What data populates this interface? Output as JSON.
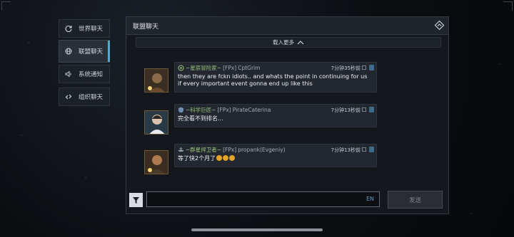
{
  "sidebar": {
    "tabs": [
      {
        "label": "世界聊天",
        "icon": "refresh-globe-icon"
      },
      {
        "label": "联盟聊天",
        "icon": "globe-icon",
        "active": true
      },
      {
        "label": "系统通知",
        "icon": "speaker-icon"
      },
      {
        "label": "组织聊天",
        "icon": "link-icon"
      }
    ]
  },
  "panel": {
    "title": "联盟聊天",
    "collapse_icon": "collapse-diamond-icon",
    "load_more": "载入更多"
  },
  "messages": [
    {
      "title": "~星辰冒险家~",
      "tag": "[FPx]",
      "name": "CptGrim",
      "time": "7分钟35秒前",
      "text": "then they are fckn idiots.. and whats the point in continuing for us if every important event gonna end up like this",
      "title_color": "#9bc27a",
      "rank_icon": "laurel-rank-icon"
    },
    {
      "title": "~科学巨匠~",
      "tag": "[FPx]",
      "name": "PirateCaterina",
      "time": "7分钟13秒前",
      "text": "完全看不到排名...",
      "title_color": "#9bc27a",
      "rank_icon": "shield-rank-icon"
    },
    {
      "title": "~群星捍卫者~",
      "tag": "[FPx]",
      "name": "propank(Evgeniy)",
      "time": "7分钟13秒前",
      "text": "等了快2个月了",
      "title_color": "#9bc27a",
      "rank_icon": "ship-rank-icon"
    }
  ],
  "input": {
    "value": "",
    "ime": "EN"
  },
  "send_label": "发送",
  "colors": {
    "accent": "#58a8c8",
    "title_green": "#9bc27a",
    "panel_bg": "#14171c"
  }
}
